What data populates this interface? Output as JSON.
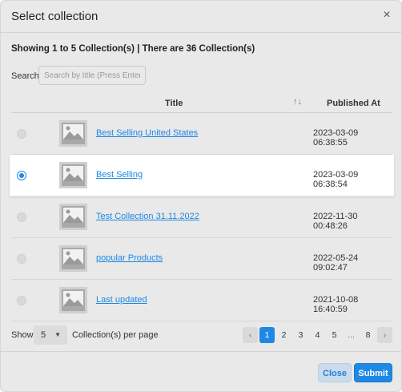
{
  "dialog": {
    "title": "Select collection",
    "close_glyph": "×"
  },
  "summary": "Showing 1 to 5 Collection(s) | There are 36 Collection(s)",
  "search": {
    "label": "Search:",
    "placeholder": "Search by title (Press Enter key)",
    "value": ""
  },
  "table": {
    "headers": {
      "title": "Title",
      "sort_glyph": "↑↓",
      "published": "Published At"
    },
    "rows": [
      {
        "title": "Best Selling United States",
        "published": "2023-03-09 06:38:55",
        "selected": false
      },
      {
        "title": "Best Selling",
        "published": "2023-03-09 06:38:54",
        "selected": true
      },
      {
        "title": "Test Collection 31.11.2022",
        "published": "2022-11-30 00:48:26",
        "selected": false
      },
      {
        "title": "popular Products",
        "published": "2022-05-24 09:02:47",
        "selected": false
      },
      {
        "title": "Last updated",
        "published": "2021-10-08 16:40:59",
        "selected": false
      }
    ]
  },
  "pagination": {
    "show_label": "Show",
    "page_size": "5",
    "per_page_label": "Collection(s) per page",
    "prev_glyph": "‹",
    "next_glyph": "›",
    "pages": [
      "1",
      "2",
      "3",
      "4",
      "5",
      "...",
      "8"
    ],
    "current": "1"
  },
  "buttons": {
    "close": "Close",
    "submit": "Submit"
  },
  "colors": {
    "accent": "#1e88e5",
    "modal_bg": "#e9e9e9",
    "selected_row_bg": "#ffffff"
  },
  "icons": {
    "thumbnail": "image-placeholder-icon",
    "close": "close-icon",
    "sort": "sort-icon",
    "caret": "chevron-down-icon"
  }
}
